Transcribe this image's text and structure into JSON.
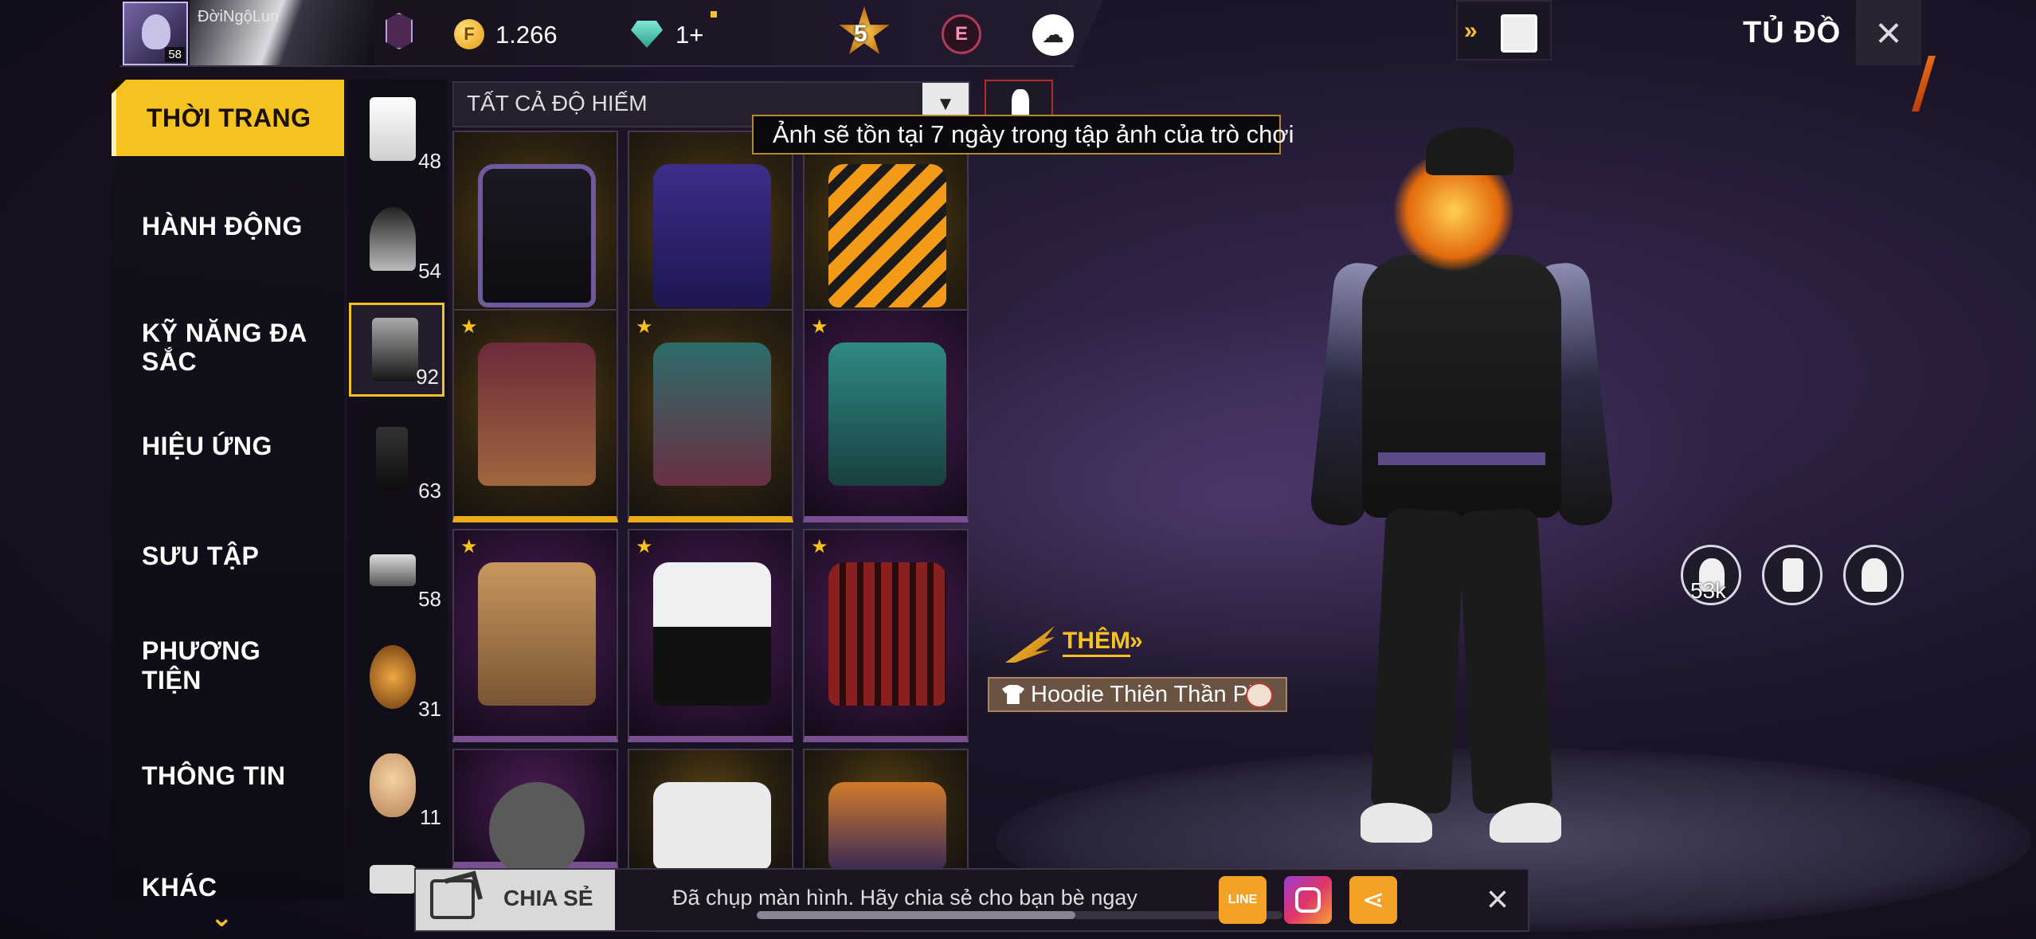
{
  "player": {
    "nickname": "ĐờiNgộLun",
    "level": "58"
  },
  "currency": {
    "coins": "1.266",
    "diamonds": "1+"
  },
  "rank": {
    "value": "5",
    "elite": "E"
  },
  "header": {
    "title": "TỦ ĐỒ",
    "close_icon": "×",
    "arrows": "»"
  },
  "categories": [
    {
      "label": "THỜI TRANG"
    },
    {
      "label": "HÀNH ĐỘNG"
    },
    {
      "label": "KỸ NĂNG ĐA SẮC"
    },
    {
      "label": "HIỆU ỨNG"
    },
    {
      "label": "SƯU TẬP"
    },
    {
      "label": "PHƯƠNG TIỆN"
    },
    {
      "label": "THÔNG TIN"
    },
    {
      "label": "KHÁC"
    }
  ],
  "subcategories": [
    {
      "name": "outfit",
      "count": "48"
    },
    {
      "name": "head",
      "count": "54"
    },
    {
      "name": "top",
      "count": "92"
    },
    {
      "name": "bottom",
      "count": "63"
    },
    {
      "name": "shoes",
      "count": "58"
    },
    {
      "name": "mask",
      "count": "31"
    },
    {
      "name": "face",
      "count": "11"
    }
  ],
  "filter": {
    "label": "TẤT CẢ ĐỘ HIẾM"
  },
  "tooltip": "Ảnh sẽ tồn tại 7 ngày trong tập ảnh của trò chơi",
  "grid_star": "★",
  "equipped": {
    "them_label": "THÊM",
    "them_arrows": "»",
    "item_name": "Hoodie Thiên Thần Pl"
  },
  "likes": "53k",
  "share": {
    "button_label": "CHIA SẺ",
    "message": "Đã chụp màn hình. Hãy chia sẻ cho bạn bè ngay",
    "line_label": "LINE",
    "share_glyph": "⋖",
    "close": "×"
  },
  "colors": {
    "accent": "#f5c21f",
    "rare_gold": "#e9ac18",
    "rare_purple": "#7a4f8f"
  }
}
